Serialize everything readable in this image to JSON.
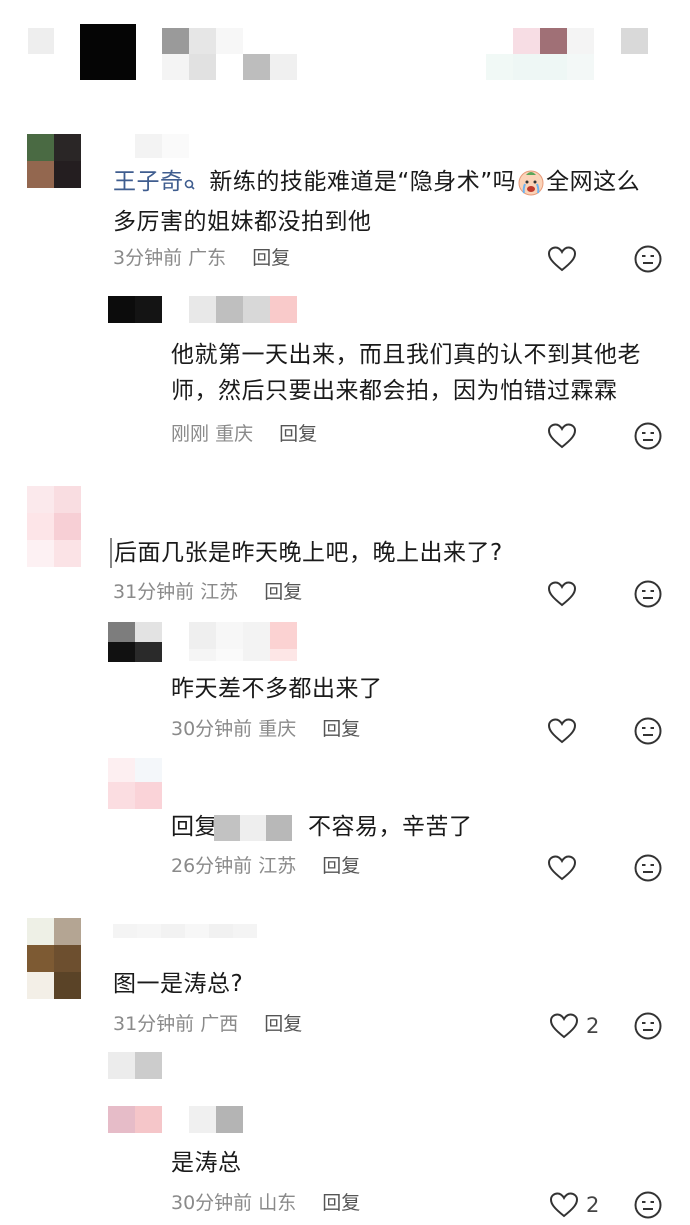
{
  "comments": [
    {
      "username": "王子奇",
      "text": "新练的技能难道是“隐身术”吗",
      "text_after_emoji": "全网这么",
      "text_line2": "多厉害的姐妹都没拍到他",
      "time": "3分钟前",
      "location": "广东",
      "reply_label": "回复",
      "replies": [
        {
          "text_line1": "他就第一天出来，而且我们真的认不到其他老",
          "text_line2": "师，然后只要出来都会拍，因为怕错过霖霖",
          "time": "刚刚",
          "location": "重庆",
          "reply_label": "回复"
        }
      ]
    },
    {
      "text": "后面几张是昨天晚上吧，晚上出来了?",
      "time": "31分钟前",
      "location": "江苏",
      "reply_label": "回复",
      "replies": [
        {
          "text": "昨天差不多都出来了",
          "time": "30分钟前",
          "location": "重庆",
          "reply_label": "回复"
        },
        {
          "prefix": "回复",
          "text": "不容易，辛苦了",
          "time": "26分钟前",
          "location": "江苏",
          "reply_label": "回复"
        }
      ]
    },
    {
      "text": "图一是涛总?",
      "time": "31分钟前",
      "location": "广西",
      "reply_label": "回复",
      "like_count": "2",
      "replies": [
        {
          "text": "是涛总",
          "time": "30分钟前",
          "location": "山东",
          "reply_label": "回复",
          "like_count": "2"
        }
      ]
    }
  ],
  "icons": {
    "like": "heart-outline-icon",
    "dislike": "neutral-face-icon",
    "verified": "search-badge-icon",
    "emoji": "crying-face-emoji"
  },
  "colors": {
    "username": "#3f5d8f",
    "meta": "#8a8a8a",
    "text": "#1a1a1a"
  }
}
